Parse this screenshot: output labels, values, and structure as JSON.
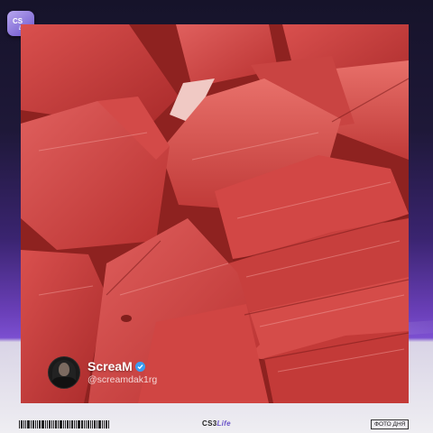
{
  "app": {
    "logo_icon": "cs3-life-logo",
    "accent_color": "#7b4fd0",
    "verified_color": "#3b9cf0"
  },
  "post": {
    "image_subject": "watermelon-slices-photo",
    "author_name": "ScreaM",
    "author_verified": true,
    "author_handle": "@screamdak1rg"
  },
  "footer": {
    "brand_prefix": "CS3",
    "brand_suffix": "Life",
    "tag": "ФОТО ДНЯ"
  }
}
